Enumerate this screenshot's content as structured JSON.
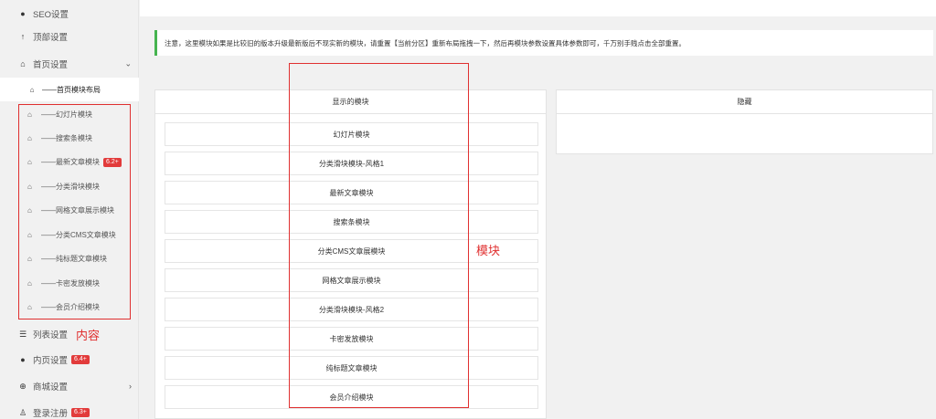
{
  "sidebar": {
    "items": [
      {
        "label": "SEO设置",
        "icon": "circle-icon"
      },
      {
        "label": "顶部设置",
        "icon": "arrow-up-icon"
      },
      {
        "label": "首页设置",
        "icon": "home-icon"
      }
    ],
    "active_label": "——首页模块布局",
    "sub_items": [
      {
        "label": "——幻灯片模块",
        "badge": ""
      },
      {
        "label": "——搜索条模块",
        "badge": ""
      },
      {
        "label": "——最新文章模块",
        "badge": "6.2+"
      },
      {
        "label": "——分类滑块模块",
        "badge": ""
      },
      {
        "label": "——网格文章展示模块",
        "badge": ""
      },
      {
        "label": "——分类CMS文章模块",
        "badge": ""
      },
      {
        "label": "——纯标题文章模块",
        "badge": ""
      },
      {
        "label": "——卡密发放模块",
        "badge": ""
      },
      {
        "label": "——会员介绍模块",
        "badge": ""
      }
    ],
    "bottom_items": [
      {
        "label": "列表设置",
        "badge": ""
      },
      {
        "label": "内页设置",
        "badge": "6.4+"
      },
      {
        "label": "商城设置",
        "badge": ""
      },
      {
        "label": "登录注册",
        "badge": "6.3+"
      }
    ]
  },
  "annotations": {
    "content_label": "内容",
    "module_label": "模块"
  },
  "notice": "注意，这里模块如果是比较旧的版本升级最新版后不现实新的模块，请重置【当前分区】重新布局拖拽一下，然后再模块参数设置具体参数即可，千万别手贱点击全部重置。",
  "visible_panel": {
    "title": "显示的模块",
    "modules": [
      "幻灯片模块",
      "分类滑块模块-风格1",
      "最新文章模块",
      "搜索条模块",
      "分类CMS文章展模块",
      "网格文章展示模块",
      "分类滑块模块-风格2",
      "卡密发放模块",
      "纯标题文章模块",
      "会员介绍模块"
    ]
  },
  "hidden_panel": {
    "title": "隐藏"
  },
  "colors": {
    "accent_green": "#46b450",
    "badge_red": "#e23b3b",
    "annotation_red": "#e03030"
  }
}
